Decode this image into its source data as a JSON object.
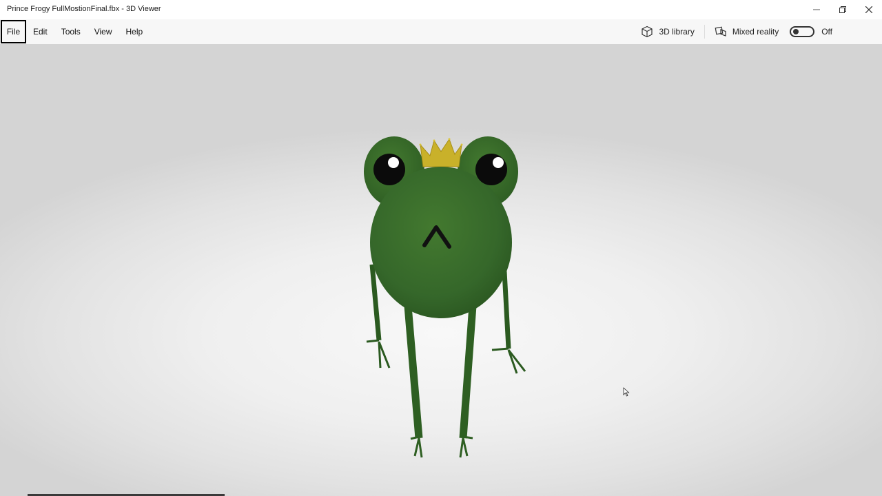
{
  "window": {
    "title": "Prince Frogy FullMostionFinal.fbx - 3D Viewer",
    "minimize_icon": "minimize-icon",
    "maximize_icon": "restore-icon",
    "close_icon": "close-icon"
  },
  "menu": {
    "items": [
      {
        "label": "File"
      },
      {
        "label": "Edit"
      },
      {
        "label": "Tools"
      },
      {
        "label": "View"
      },
      {
        "label": "Help"
      }
    ],
    "library_label": "3D library",
    "mixed_reality_label": "Mixed reality",
    "mixed_reality_state": "Off"
  },
  "colors": {
    "frog_green": "#3a6b2c",
    "frog_dark": "#24451a",
    "crown_gold": "#c9b12a"
  }
}
